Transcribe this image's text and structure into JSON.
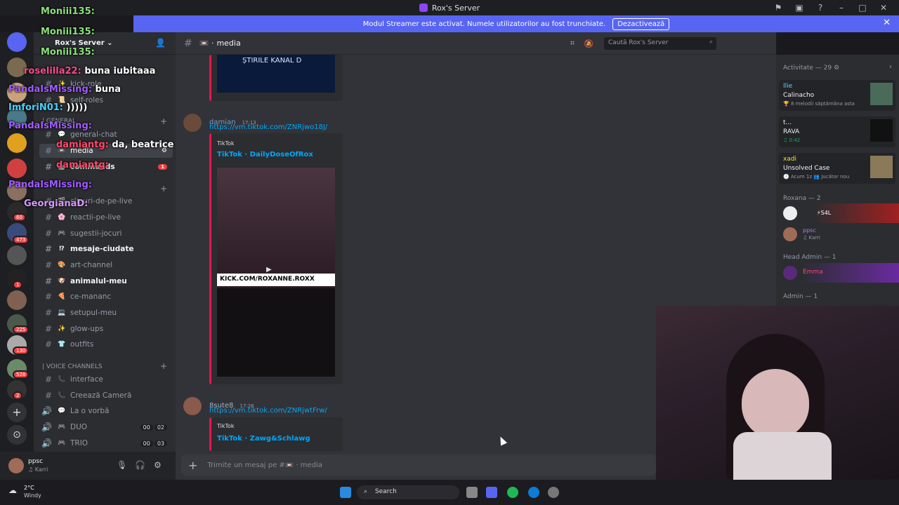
{
  "window": {
    "title": "Rox's Server"
  },
  "banner": {
    "text": "Modul Streamer este activat. Numele utilizatorilor au fost trunchiate.",
    "button": "Dezactivează"
  },
  "server": {
    "name": "Rox's Server ⌄"
  },
  "rail_badges": [
    "60",
    "473",
    "1",
    "225",
    "130",
    "528",
    "2"
  ],
  "channels": {
    "items": [
      {
        "name": "kick-role",
        "emoji": "✨"
      },
      {
        "name": "self-roles",
        "emoji": "📜"
      },
      {
        "name": "general-chat",
        "emoji": "💬"
      },
      {
        "name": "media",
        "emoji": "📼",
        "active": true
      },
      {
        "name": "commands",
        "emoji": "🤖",
        "badge": "1"
      },
      {
        "name": "clipuri-de-pe-live",
        "emoji": "🎬"
      },
      {
        "name": "reactii-pe-live",
        "emoji": "🌸"
      },
      {
        "name": "sugestii-jocuri",
        "emoji": "🎮"
      },
      {
        "name": "mesaje-ciudate",
        "emoji": "⁉",
        "bold": true
      },
      {
        "name": "art-channel",
        "emoji": "🎨"
      },
      {
        "name": "animalul-meu",
        "emoji": "🐶",
        "bold": true
      },
      {
        "name": "ce-mananc",
        "emoji": "🍕"
      },
      {
        "name": "setupul-meu",
        "emoji": "💻"
      },
      {
        "name": "glow-ups",
        "emoji": "✨"
      },
      {
        "name": "outfits",
        "emoji": "👕"
      }
    ],
    "general_cat": "| GENERAL",
    "voice_cat": "| VOICE CHANNELS",
    "voice": [
      {
        "name": "interface",
        "emoji": "📞"
      },
      {
        "name": "Creează Cameră",
        "emoji": "📞"
      },
      {
        "name": "La o vorbă",
        "emoji": "💬"
      },
      {
        "name": "DUO",
        "emoji": "🎮",
        "count": [
          "00",
          "02"
        ]
      },
      {
        "name": "TRIO",
        "emoji": "🎮",
        "count": [
          "00",
          "03"
        ]
      }
    ]
  },
  "user": {
    "name": "ppsc",
    "status": "♫ Karri"
  },
  "channel_header": {
    "name": "media"
  },
  "search": {
    "placeholder": "Caută Rox's Server"
  },
  "messages": [
    {
      "embed_text": "ȘTIRILE KANAL D"
    },
    {
      "author": "damian",
      "time": "17:13",
      "link": "https://vm.tiktok.com/ZNRjwo18J/",
      "provider": "TikTok",
      "title": "TikTok · DailyDoseOfRox",
      "video_caption": "KICK.COM/ROXANNE.ROXX"
    },
    {
      "author": "8sute8",
      "time": "17:26",
      "link": "https://vm.tiktok.com/ZNRjwtFrw/",
      "provider": "TikTok",
      "title": "TikTok · Zawg&Schlawg"
    }
  ],
  "composer": {
    "placeholder": "Trimite un mesaj pe #📼 · media"
  },
  "members": {
    "activity_header": "Activitate — 29 ⚙",
    "activities": [
      {
        "user": "Ilie",
        "title": "Calinacho",
        "sub": "🏆 8 melodii săptămâna asta"
      },
      {
        "user": "t...",
        "title": "RAVA",
        "sub": "♫ 0:42"
      },
      {
        "user": "xadi",
        "title": "Unsolved Case",
        "sub": "🕑 Acum 1z  👥 Jucător nou"
      }
    ],
    "roxana_header": "Roxana — 2",
    "roxana_members": [
      {
        "name": "⚡S4L"
      },
      {
        "name": "ppsc",
        "sub": "♫ Karri"
      }
    ],
    "head_admin_header": "Head Admin — 1",
    "head_admin": "Emma",
    "admin_header": "Admin — 1"
  },
  "overlay_chat": [
    {
      "name": "Moniii135:",
      "msg": ""
    },
    {
      "name": "Moniii135:",
      "msg": ""
    },
    {
      "name": "Moniii135:",
      "msg": ""
    },
    {
      "name": "roselilla22:",
      "msg": "buna iubitaaa"
    },
    {
      "name": "PandaIsMissing:",
      "msg": "buna"
    },
    {
      "name": "ImforiN01:",
      "msg": ")))))"
    },
    {
      "name": "PandaIsMissing:",
      "msg": ""
    },
    {
      "name": "damiantg:",
      "msg": "da, beatrice"
    },
    {
      "name": "damiantg:",
      "msg": ""
    },
    {
      "name": "PandaIsMissing:",
      "msg": ""
    },
    {
      "name": "GeorgianaD:",
      "msg": ""
    }
  ],
  "taskbar": {
    "weather_temp": "2°C",
    "weather_desc": "Windy",
    "search": "Search"
  },
  "colors": {
    "accent": "#5865f2",
    "embed_border": "#e9164f",
    "overlay_name": "#a25bff"
  }
}
